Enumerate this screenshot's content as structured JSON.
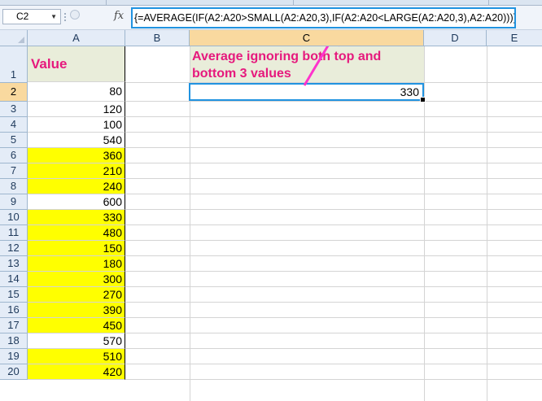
{
  "formula_bar": {
    "name_box": "C2",
    "fx_label": "fx",
    "formula": "{=AVERAGE(IF(A2:A20>SMALL(A2:A20,3),IF(A2:A20<LARGE(A2:A20,3),A2:A20)))}"
  },
  "columns": [
    "A",
    "B",
    "C",
    "D",
    "E"
  ],
  "rows": [
    "1",
    "2",
    "3",
    "4",
    "5",
    "6",
    "7",
    "8",
    "9",
    "10",
    "11",
    "12",
    "13",
    "14",
    "15",
    "16",
    "17",
    "18",
    "19",
    "20"
  ],
  "sheet": {
    "a1_header": "Value",
    "c1_note": "Average ignoring both top and bottom 3 values",
    "c2_result": "330",
    "a_values": [
      "80",
      "120",
      "100",
      "540",
      "360",
      "210",
      "240",
      "600",
      "330",
      "480",
      "150",
      "180",
      "300",
      "270",
      "390",
      "450",
      "570",
      "510",
      "420"
    ],
    "a_highlighted": [
      false,
      false,
      false,
      false,
      true,
      true,
      true,
      false,
      true,
      true,
      true,
      true,
      true,
      true,
      true,
      true,
      false,
      true,
      true
    ]
  },
  "colors": {
    "highlight": "#ffff00",
    "note_text": "#e6197d",
    "selection_border": "#2193e0",
    "arrow": "#ff33cc"
  }
}
